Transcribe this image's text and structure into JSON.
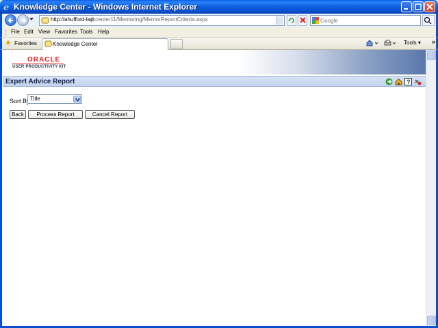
{
  "window": {
    "title": "Knowledge Center - Windows Internet Explorer"
  },
  "addressbar": {
    "url_host": "http://ahufford-lap",
    "url_path": "/kcenter11/Mentoring/MentorReportCriteria.aspx",
    "search_placeholder": "Google"
  },
  "menu": {
    "items": [
      "File",
      "Edit",
      "View",
      "Favorites",
      "Tools",
      "Help"
    ]
  },
  "tabbar": {
    "favorites_label": "Favorites",
    "tab_label": "Knowledge Center",
    "tools_label": "Tools"
  },
  "banner": {
    "logo_text": "ORACLE",
    "logo_subtext": "USER PRODUCTIVITY KIT"
  },
  "page": {
    "title": "Expert Advice Report",
    "sort_label": "Sort By",
    "sort_value": "Title",
    "buttons": {
      "back": "Back",
      "process": "Process Report",
      "cancel": "Cancel Report"
    }
  },
  "icons": {
    "title_bar_buttons": [
      "minimize-icon",
      "maximize-icon",
      "close-icon"
    ],
    "page_actions": [
      "go-icon",
      "home-icon",
      "help-icon",
      "close-window-icon"
    ]
  },
  "colors": {
    "titlebar": "#0a5ee6",
    "page_bar": "#c3d4ee",
    "oracle_red": "#e01b1b"
  }
}
